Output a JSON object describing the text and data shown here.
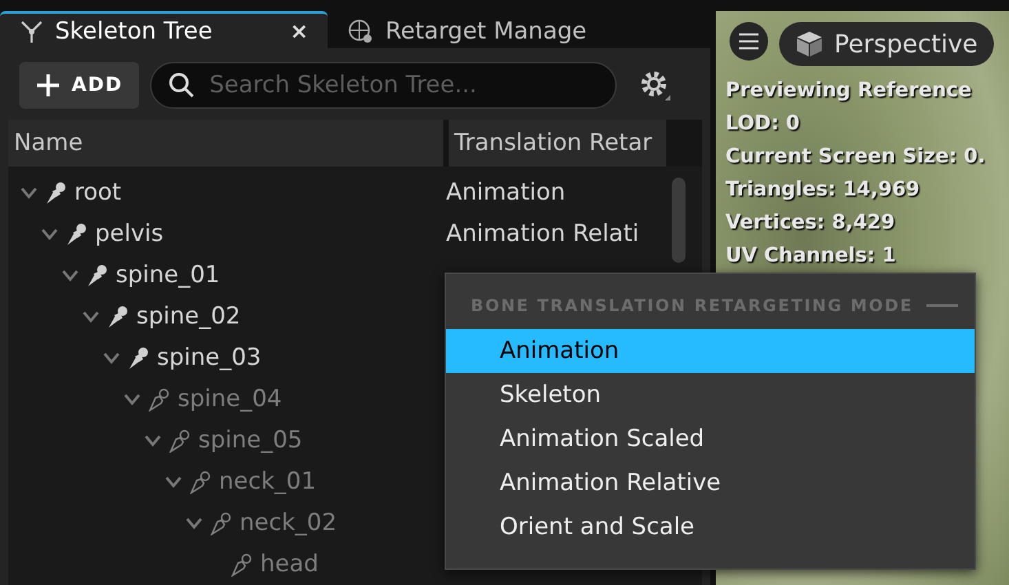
{
  "tabs": [
    {
      "label": "Skeleton Tree",
      "selected": true,
      "close": "×"
    },
    {
      "label": "Retarget Manage",
      "selected": false
    }
  ],
  "toolbar": {
    "add_label": "ADD",
    "search": {
      "placeholder": "Search Skeleton Tree..."
    }
  },
  "table": {
    "columns": [
      "Name",
      "Translation Retar"
    ],
    "rows": [
      {
        "name": "root",
        "weighted": true,
        "expanded": true,
        "translation": "Animation",
        "children": [
          {
            "name": "pelvis",
            "weighted": true,
            "expanded": true,
            "translation": "Animation Relati",
            "children": [
              {
                "name": "spine_01",
                "weighted": true,
                "expanded": true,
                "children": [
                  {
                    "name": "spine_02",
                    "weighted": true,
                    "expanded": true,
                    "children": [
                      {
                        "name": "spine_03",
                        "weighted": true,
                        "expanded": true,
                        "children": [
                          {
                            "name": "spine_04",
                            "weighted": false,
                            "expanded": true,
                            "children": [
                              {
                                "name": "spine_05",
                                "weighted": false,
                                "expanded": true,
                                "children": [
                                  {
                                    "name": "neck_01",
                                    "weighted": false,
                                    "expanded": true,
                                    "children": [
                                      {
                                        "name": "neck_02",
                                        "weighted": false,
                                        "expanded": true,
                                        "children": [
                                          {
                                            "name": "head",
                                            "weighted": false
                                          }
                                        ]
                                      }
                                    ]
                                  }
                                ]
                              }
                            ]
                          }
                        ]
                      }
                    ]
                  }
                ]
              }
            ]
          }
        ]
      }
    ]
  },
  "viewport": {
    "view_label": "Perspective",
    "stats": [
      "Previewing Reference",
      "LOD: 0",
      "Current Screen Size: 0.",
      "Triangles: 14,969",
      "Vertices: 8,429",
      "UV Channels: 1"
    ]
  },
  "popup": {
    "title": "BONE TRANSLATION RETARGETING MODE",
    "items": [
      {
        "label": "Animation",
        "selected": true
      },
      {
        "label": "Skeleton",
        "selected": false
      },
      {
        "label": "Animation Scaled",
        "selected": false
      },
      {
        "label": "Animation Relative",
        "selected": false
      },
      {
        "label": "Orient and Scale",
        "selected": false
      }
    ]
  }
}
